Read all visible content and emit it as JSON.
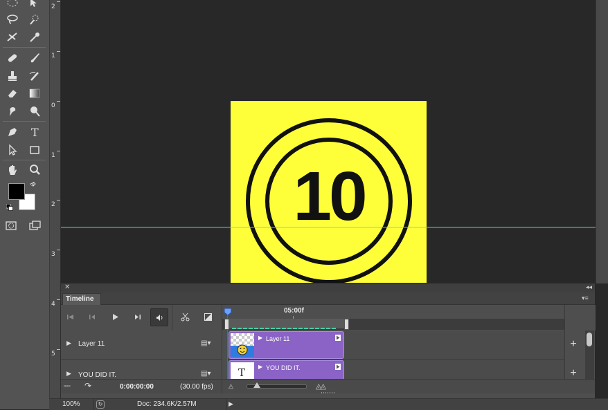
{
  "ruler": {
    "labels": [
      "2",
      "1",
      "0",
      "1",
      "2",
      "3",
      "4",
      "5"
    ]
  },
  "canvas": {
    "number_text": "10",
    "artboard_color": "#ffff39"
  },
  "timeline": {
    "tab_label": "Timeline",
    "time_marker": "05:00f",
    "timecode": "0:00:00:00",
    "fps": "(30.00 fps)",
    "layers": [
      {
        "name": "Layer 11",
        "clip_label": "Layer 11"
      },
      {
        "name": "YOU DID IT.",
        "clip_label": "YOU DID IT."
      }
    ]
  },
  "status": {
    "zoom": "100%",
    "doc": "Doc: 234.6K/2.57M"
  },
  "colors": {
    "foreground": "#000000",
    "background": "#ffffff",
    "clip": "#8b63c7",
    "guide": "#5fd8e6"
  }
}
